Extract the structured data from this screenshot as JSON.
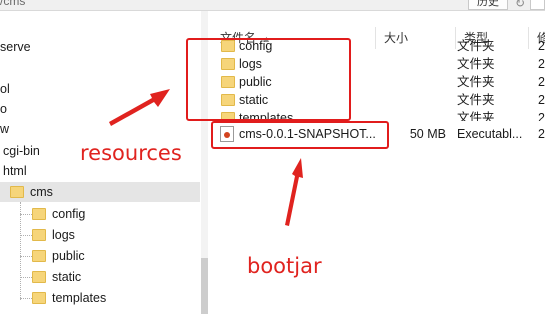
{
  "address": {
    "path_fragment": "/cms",
    "history_label": "历史"
  },
  "tree": {
    "items": [
      {
        "label": "serve"
      },
      {
        "label": "ol"
      },
      {
        "label": "o"
      },
      {
        "label": "w"
      },
      {
        "label": "cgi-bin"
      },
      {
        "label": "html"
      },
      {
        "label": "cms"
      },
      {
        "label": "config"
      },
      {
        "label": "logs"
      },
      {
        "label": "public"
      },
      {
        "label": "static"
      },
      {
        "label": "templates"
      }
    ]
  },
  "file_list": {
    "columns": {
      "name": "文件名",
      "size": "大小",
      "type": "类型",
      "modified": "修"
    },
    "rows": [
      {
        "name": "config",
        "size": "",
        "type": "文件夹",
        "modified": "2(",
        "icon": "folder-icon"
      },
      {
        "name": "logs",
        "size": "",
        "type": "文件夹",
        "modified": "2(",
        "icon": "folder-icon"
      },
      {
        "name": "public",
        "size": "",
        "type": "文件夹",
        "modified": "2(",
        "icon": "folder-icon"
      },
      {
        "name": "static",
        "size": "",
        "type": "文件夹",
        "modified": "2(",
        "icon": "folder-icon"
      },
      {
        "name": "templates",
        "size": "",
        "type": "文件夹",
        "modified": "2(",
        "icon": "folder-icon"
      },
      {
        "name": "cms-0.0.1-SNAPSHOT...",
        "size": "50 MB",
        "type": "Executabl...",
        "modified": "2(",
        "icon": "jar-icon"
      }
    ]
  },
  "annotations": {
    "resources": "resources",
    "bootjar": "bootjar"
  },
  "colors": {
    "annotation_red": "#e0231f",
    "folder_yellow": "#f6d57a",
    "selection": "#e5e5e5"
  }
}
